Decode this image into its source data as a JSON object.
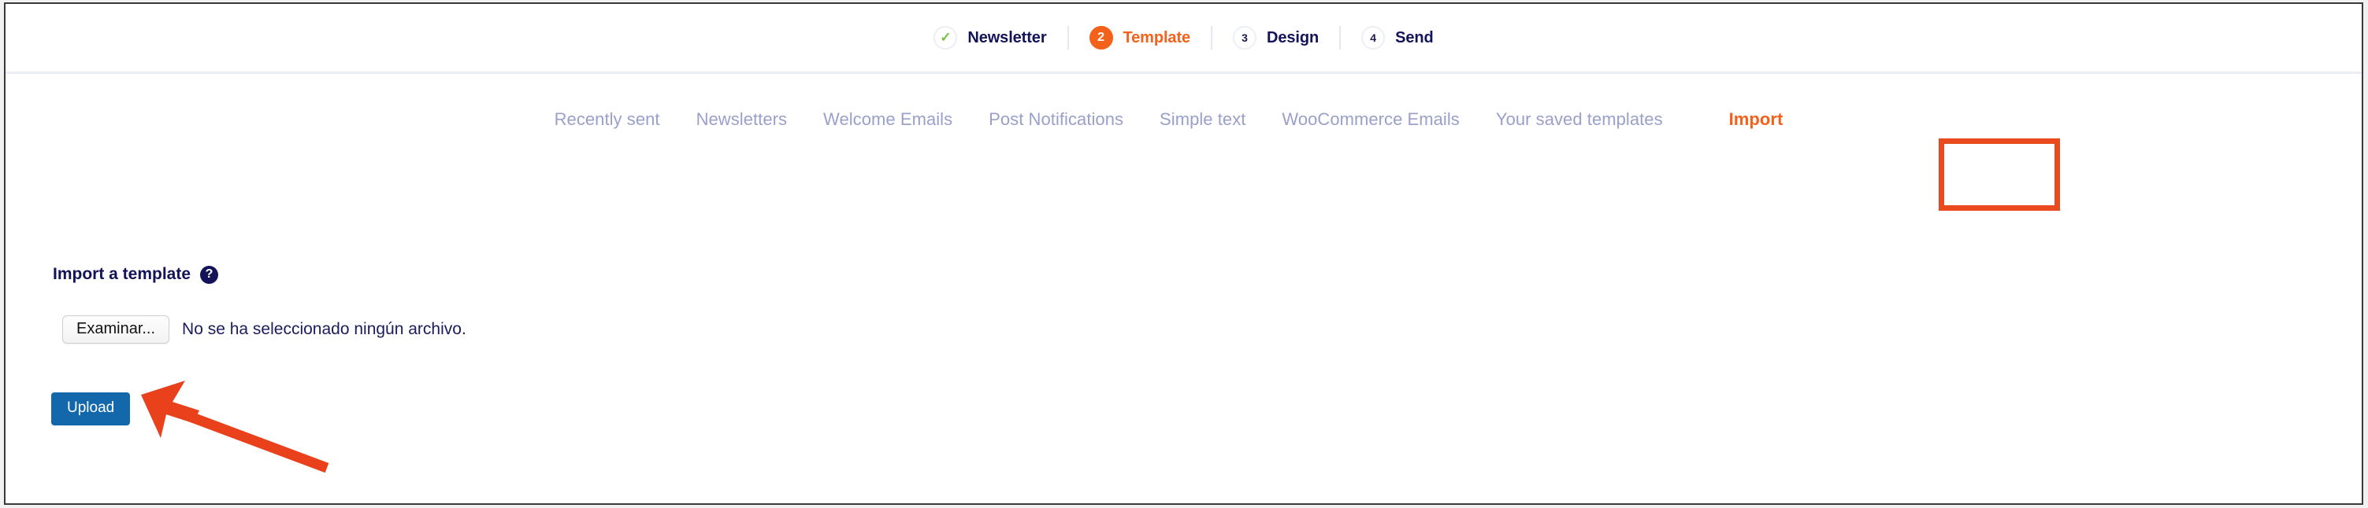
{
  "steps": [
    {
      "marker": "✓",
      "marker_type": "done",
      "label": "Newsletter"
    },
    {
      "marker": "2",
      "marker_type": "current",
      "label": "Template"
    },
    {
      "marker": "3",
      "marker_type": "todo",
      "label": "Design"
    },
    {
      "marker": "4",
      "marker_type": "todo",
      "label": "Send"
    }
  ],
  "tabs": [
    {
      "label": "Recently sent",
      "active": false
    },
    {
      "label": "Newsletters",
      "active": false
    },
    {
      "label": "Welcome Emails",
      "active": false
    },
    {
      "label": "Post Notifications",
      "active": false
    },
    {
      "label": "Simple text",
      "active": false
    },
    {
      "label": "WooCommerce Emails",
      "active": false
    },
    {
      "label": "Your saved templates",
      "active": false
    },
    {
      "label": "Import",
      "active": true
    }
  ],
  "form": {
    "title": "Import a template",
    "help_icon": "?",
    "browse_label": "Examinar...",
    "file_status": "No se ha seleccionado ningún archivo.",
    "upload_label": "Upload"
  },
  "colors": {
    "accent_orange": "#f4611b",
    "annotation_red": "#ea4a1f",
    "upload_blue": "#1268ab",
    "navy": "#13135a",
    "tab_muted": "#9aa0cb",
    "check_green": "#76c043"
  }
}
